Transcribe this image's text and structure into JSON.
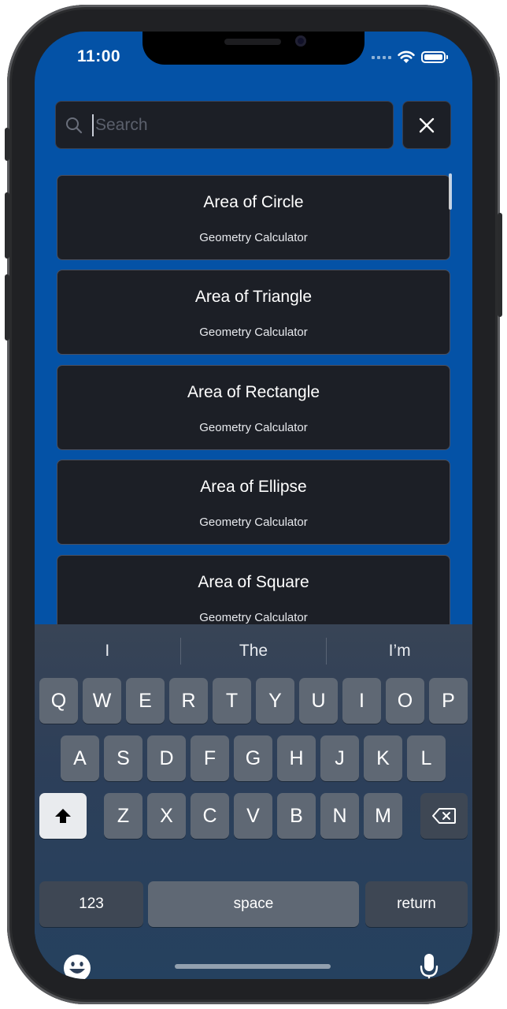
{
  "status_bar": {
    "time": "11:00",
    "icons": [
      "signal-icon",
      "wifi-icon",
      "battery-icon"
    ]
  },
  "search": {
    "placeholder": "Search",
    "value": "",
    "icon": "search-icon",
    "clear_icon": "close-icon"
  },
  "results": [
    {
      "title": "Area of Circle",
      "subtitle": "Geometry Calculator"
    },
    {
      "title": "Area of Triangle",
      "subtitle": "Geometry Calculator"
    },
    {
      "title": "Area of Rectangle",
      "subtitle": "Geometry Calculator"
    },
    {
      "title": "Area of Ellipse",
      "subtitle": "Geometry Calculator"
    },
    {
      "title": "Area of Square",
      "subtitle": "Geometry Calculator"
    }
  ],
  "keyboard": {
    "suggestions": [
      "I",
      "The",
      "I’m"
    ],
    "row1": [
      "Q",
      "W",
      "E",
      "R",
      "T",
      "Y",
      "U",
      "I",
      "O",
      "P"
    ],
    "row2": [
      "A",
      "S",
      "D",
      "F",
      "G",
      "H",
      "J",
      "K",
      "L"
    ],
    "row3": [
      "Z",
      "X",
      "C",
      "V",
      "B",
      "N",
      "M"
    ],
    "numbers_label": "123",
    "space_label": "space",
    "return_label": "return",
    "icons": [
      "shift-icon",
      "backspace-icon",
      "emoji-icon",
      "microphone-icon"
    ]
  },
  "colors": {
    "background": "#0452a6",
    "card": "#1c1f26",
    "keyboard": "#2d3f59"
  }
}
